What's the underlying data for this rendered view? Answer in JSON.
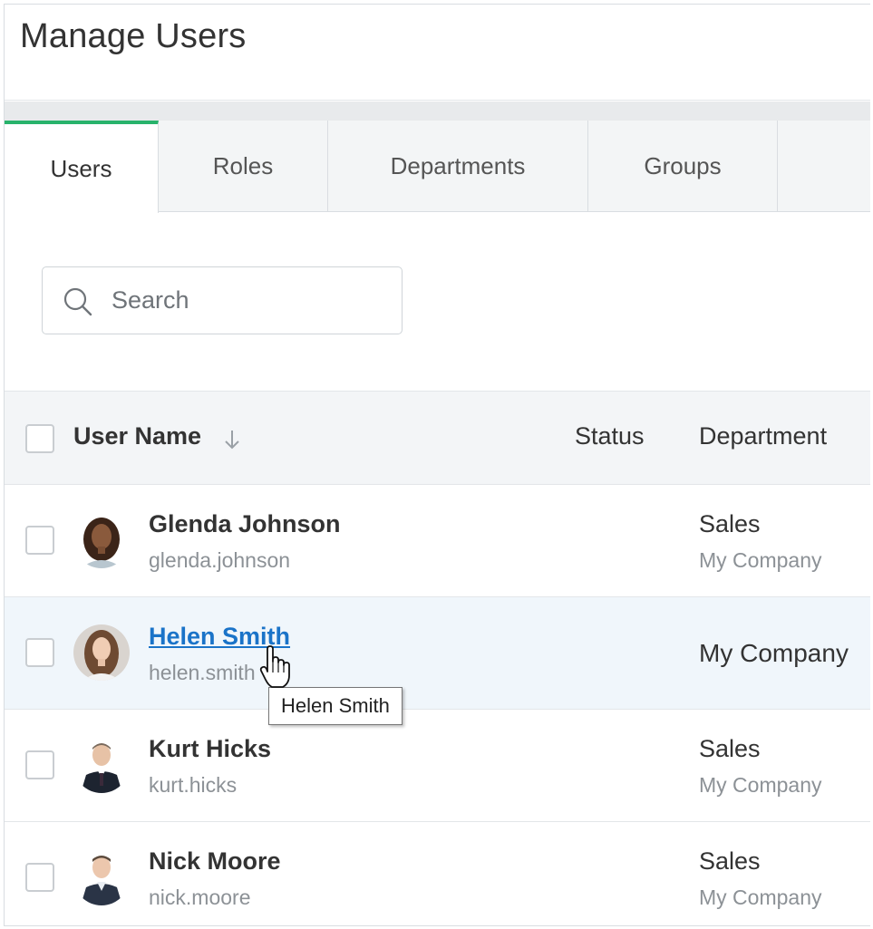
{
  "page": {
    "title": "Manage Users"
  },
  "tabs": [
    {
      "label": "Users",
      "active": true
    },
    {
      "label": "Roles",
      "active": false
    },
    {
      "label": "Departments",
      "active": false
    },
    {
      "label": "Groups",
      "active": false
    }
  ],
  "search": {
    "placeholder": "Search",
    "value": ""
  },
  "table": {
    "headers": {
      "user_name": "User Name",
      "status": "Status",
      "department": "Department"
    },
    "rows": [
      {
        "name": "Glenda Johnson",
        "login": "glenda.johnson",
        "status": "",
        "department": "Sales",
        "company": "My Company"
      },
      {
        "name": "Helen Smith",
        "login": "helen.smith",
        "status": "",
        "department": "My Company",
        "company": ""
      },
      {
        "name": "Kurt Hicks",
        "login": "kurt.hicks",
        "status": "",
        "department": "Sales",
        "company": "My Company"
      },
      {
        "name": "Nick Moore",
        "login": "nick.moore",
        "status": "",
        "department": "Sales",
        "company": "My Company"
      }
    ]
  },
  "tooltip": {
    "text": "Helen Smith"
  },
  "colors": {
    "accent_tab": "#28b36b",
    "link": "#1a73c8",
    "hover_row": "#f0f6fb"
  }
}
